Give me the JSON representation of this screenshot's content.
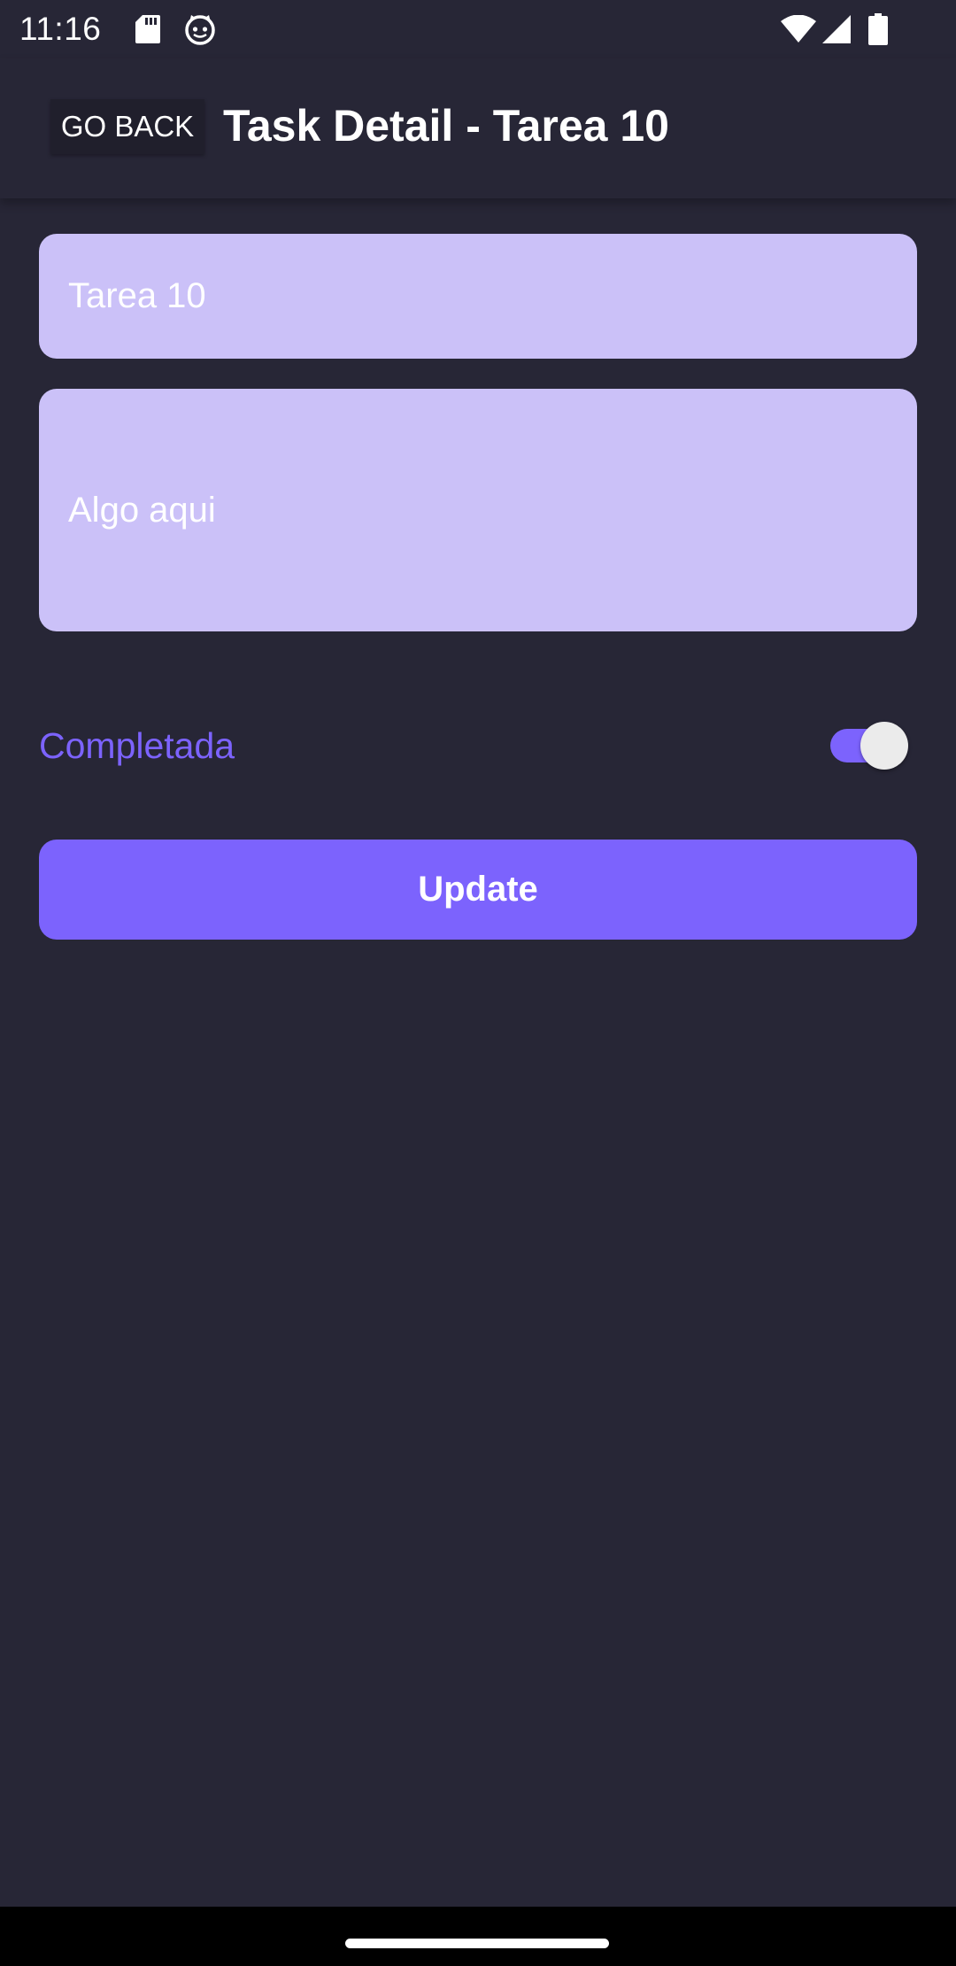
{
  "status_bar": {
    "time": "11:16",
    "left_icons": [
      "sd-card-icon",
      "cat-face-icon"
    ],
    "right_icons": [
      "wifi-icon",
      "cellular-signal-icon",
      "battery-icon"
    ]
  },
  "header": {
    "back_label": "GO BACK",
    "title": "Task Detail - Tarea 10"
  },
  "form": {
    "title_value": "Tarea 10",
    "description_value": "Algo aqui",
    "completed_label": "Completada",
    "completed": true,
    "update_label": "Update"
  },
  "colors": {
    "background": "#272636",
    "field_background": "#cbc1f8",
    "accent": "#7c63fd",
    "switch_thumb": "#ebebeb"
  }
}
